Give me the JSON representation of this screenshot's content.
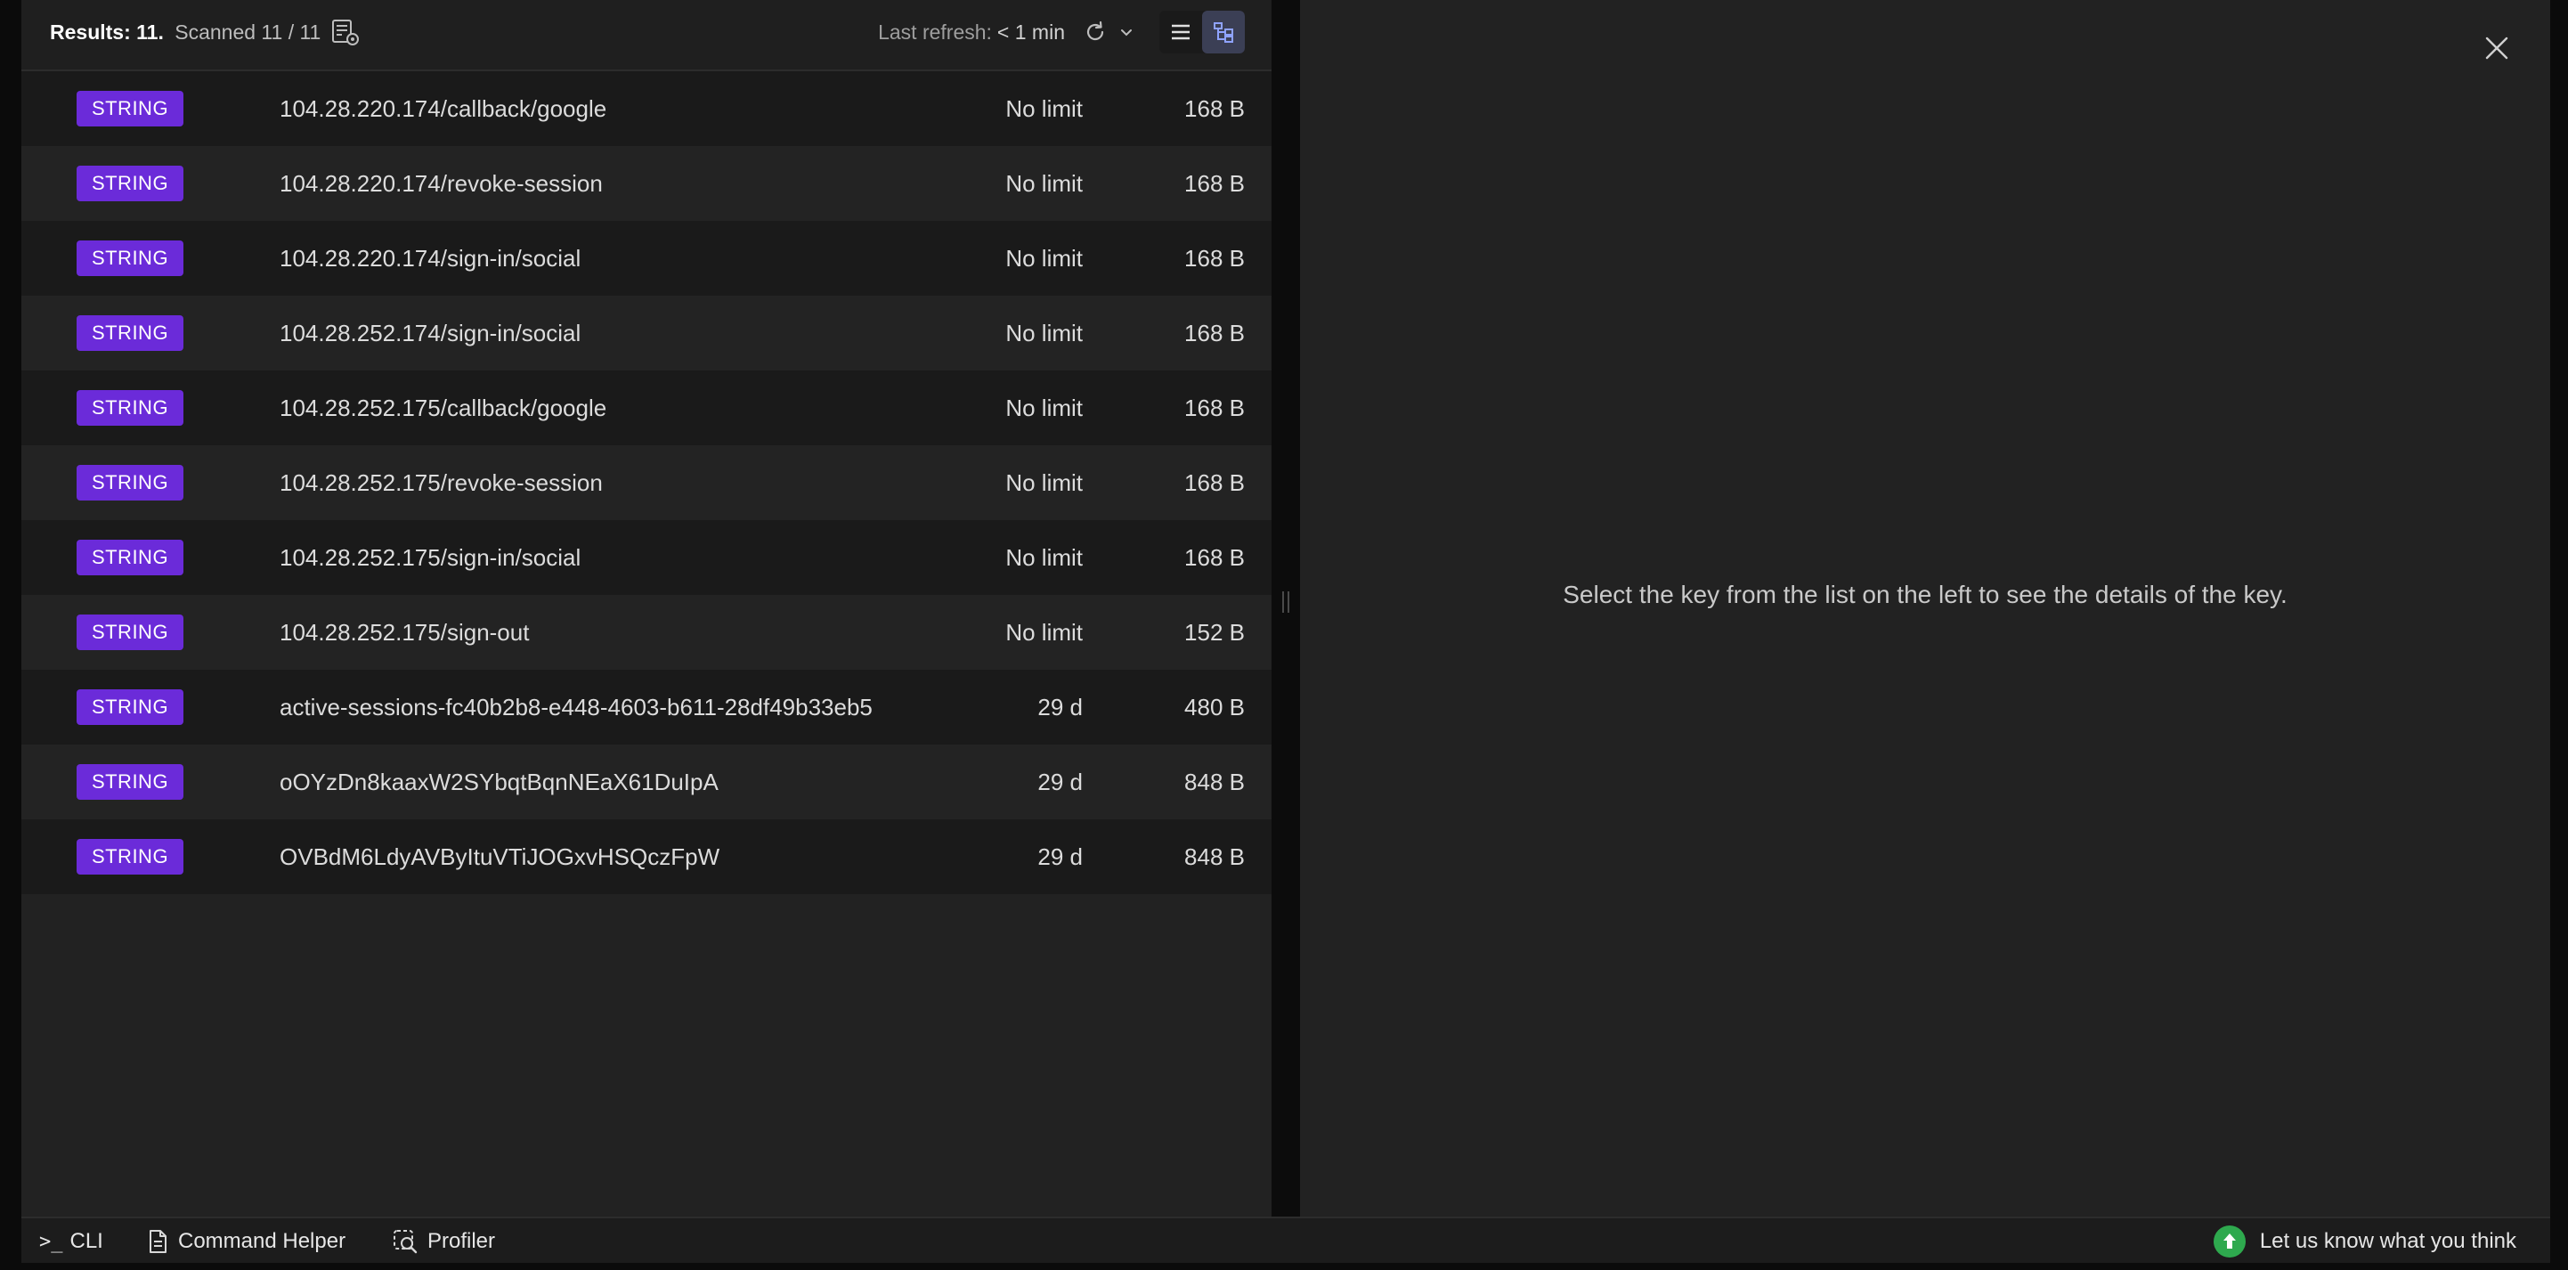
{
  "toolbar": {
    "results_label": "Results: 11.",
    "scanned_text": "Scanned 11 / 11",
    "last_refresh_label": "Last refresh:",
    "last_refresh_value": "< 1 min"
  },
  "keys": [
    {
      "type": "STRING",
      "name": "104.28.220.174/callback/google",
      "ttl": "No limit",
      "size": "168 B"
    },
    {
      "type": "STRING",
      "name": "104.28.220.174/revoke-session",
      "ttl": "No limit",
      "size": "168 B"
    },
    {
      "type": "STRING",
      "name": "104.28.220.174/sign-in/social",
      "ttl": "No limit",
      "size": "168 B"
    },
    {
      "type": "STRING",
      "name": "104.28.252.174/sign-in/social",
      "ttl": "No limit",
      "size": "168 B"
    },
    {
      "type": "STRING",
      "name": "104.28.252.175/callback/google",
      "ttl": "No limit",
      "size": "168 B"
    },
    {
      "type": "STRING",
      "name": "104.28.252.175/revoke-session",
      "ttl": "No limit",
      "size": "168 B"
    },
    {
      "type": "STRING",
      "name": "104.28.252.175/sign-in/social",
      "ttl": "No limit",
      "size": "168 B"
    },
    {
      "type": "STRING",
      "name": "104.28.252.175/sign-out",
      "ttl": "No limit",
      "size": "152 B"
    },
    {
      "type": "STRING",
      "name": "active-sessions-fc40b2b8-e448-4603-b611-28df49b33eb5",
      "ttl": "29 d",
      "size": "480 B"
    },
    {
      "type": "STRING",
      "name": "oOYzDn8kaaxW2SYbqtBqnNEaX61DuIpA",
      "ttl": "29 d",
      "size": "848 B"
    },
    {
      "type": "STRING",
      "name": "OVBdM6LdyAVByItuVTiJOGxvHSQczFpW",
      "ttl": "29 d",
      "size": "848 B"
    }
  ],
  "details": {
    "empty_message": "Select the key from the list on the left to see the details of the key."
  },
  "bottom_bar": {
    "cli_prompt": ">_",
    "cli_label": "CLI",
    "command_helper_label": "Command Helper",
    "profiler_label": "Profiler",
    "feedback_label": "Let us know what you think"
  },
  "colors": {
    "type_badge_string": "#6b2bd9",
    "feedback_icon": "#2ea94e",
    "active_view": "#3b3f55"
  },
  "icons": {
    "scan_settings": "scan-settings-icon",
    "refresh": "refresh-icon",
    "dropdown": "chevron-down-icon",
    "list_view": "list-view-icon",
    "tree_view": "tree-view-icon",
    "close": "close-icon",
    "command_helper": "document-icon",
    "profiler": "profiler-icon",
    "feedback": "feedback-icon"
  }
}
